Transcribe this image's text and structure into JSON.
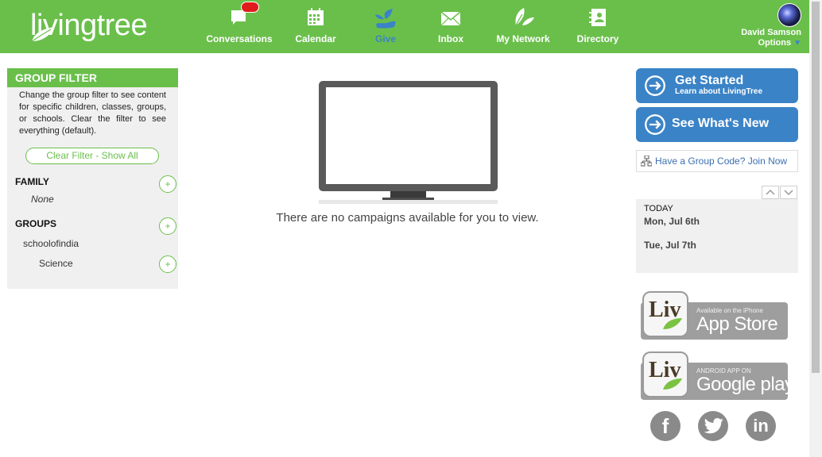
{
  "brand": {
    "logo_text": "livingtree"
  },
  "nav": {
    "items": [
      {
        "label": "Conversations",
        "icon": "chat-icon"
      },
      {
        "label": "Calendar",
        "icon": "calendar-icon"
      },
      {
        "label": "Give",
        "icon": "give-icon",
        "active": true
      },
      {
        "label": "Inbox",
        "icon": "envelope-icon"
      },
      {
        "label": "My Network",
        "icon": "network-leaf-icon"
      },
      {
        "label": "Directory",
        "icon": "directory-icon"
      }
    ]
  },
  "user": {
    "name": "David Samson",
    "options_label": "Options"
  },
  "group_filter": {
    "title": "GROUP FILTER",
    "description": "Change the group filter to see content for specific children, classes, groups, or schools. Clear the filter to see everything (default).",
    "clear_label": "Clear Filter - Show All",
    "family": {
      "title": "FAMILY",
      "items": [
        "None"
      ]
    },
    "groups": {
      "title": "GROUPS",
      "items": [
        "schoolofindia",
        "Science"
      ]
    },
    "plus_label": "+"
  },
  "main": {
    "empty_message": "There are no campaigns available for you to view."
  },
  "right": {
    "get_started": {
      "title": "Get Started",
      "subtitle": "Learn about LivingTree"
    },
    "whats_new": {
      "title": "See What's New"
    },
    "group_code": "Have a Group Code? Join Now",
    "calendar": {
      "today_label": "TODAY",
      "dates": [
        "Mon, Jul 6th",
        "Tue, Jul 7th"
      ]
    },
    "app_store": {
      "small": "Available on the iPhone",
      "big": "App Store",
      "logo": "Liv"
    },
    "google_play": {
      "small": "ANDROID APP ON",
      "big": "Google play",
      "logo": "Liv"
    },
    "social": [
      {
        "name": "facebook-icon",
        "glyph": "f"
      },
      {
        "name": "twitter-icon",
        "glyph": "t"
      },
      {
        "name": "linkedin-icon",
        "glyph": "in"
      }
    ]
  },
  "colors": {
    "brand_green": "#6abf4b",
    "accent_blue": "#3b83c7",
    "panel_gray": "#f0f0f0"
  }
}
